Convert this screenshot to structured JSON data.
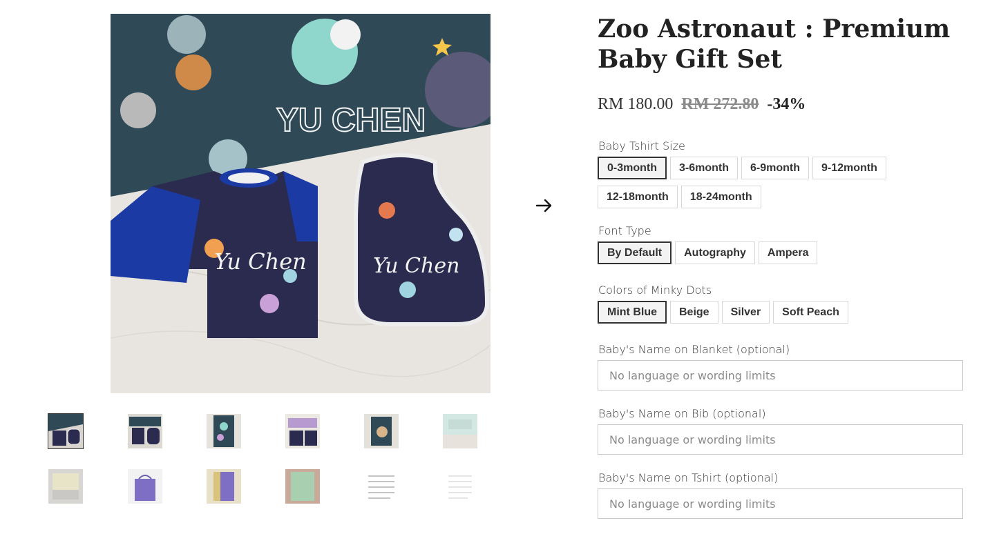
{
  "product": {
    "title": "Zoo Astronaut : Premium Baby Gift Set",
    "price_current": "RM 180.00",
    "price_original": "RM 272.80",
    "discount": "-34%"
  },
  "gallery": {
    "main_image_name_blanket": "YU CHEN",
    "main_image_name_shirt": "Yu Chen",
    "main_image_name_bib": "Yu Chen",
    "thumbnail_count": 12
  },
  "options": {
    "tshirt_size": {
      "label": "Baby Tshirt Size",
      "values": [
        "0-3month",
        "3-6month",
        "6-9month",
        "9-12month",
        "12-18month",
        "18-24month"
      ],
      "selected": "0-3month"
    },
    "font_type": {
      "label": "Font Type",
      "values": [
        "By Default",
        "Autography",
        "Ampera"
      ],
      "selected": "By Default"
    },
    "minky_colors": {
      "label": "Colors of Minky Dots",
      "values": [
        "Mint Blue",
        "Beige",
        "Silver",
        "Soft Peach"
      ],
      "selected": "Mint Blue"
    }
  },
  "fields": {
    "blanket": {
      "label": "Baby's Name on Blanket (optional)",
      "placeholder": "No language or wording limits",
      "value": ""
    },
    "bib": {
      "label": "Baby's Name on Bib (optional)",
      "placeholder": "No language or wording limits",
      "value": ""
    },
    "tshirt": {
      "label": "Baby's Name on Tshirt (optional)",
      "placeholder": "No language or wording limits",
      "value": ""
    }
  },
  "icons": {
    "next": "arrow-right-icon"
  },
  "colors": {
    "text": "#222222",
    "border": "#d8d8d8",
    "selected_border": "#333333",
    "old_price": "#8a8a8a"
  }
}
